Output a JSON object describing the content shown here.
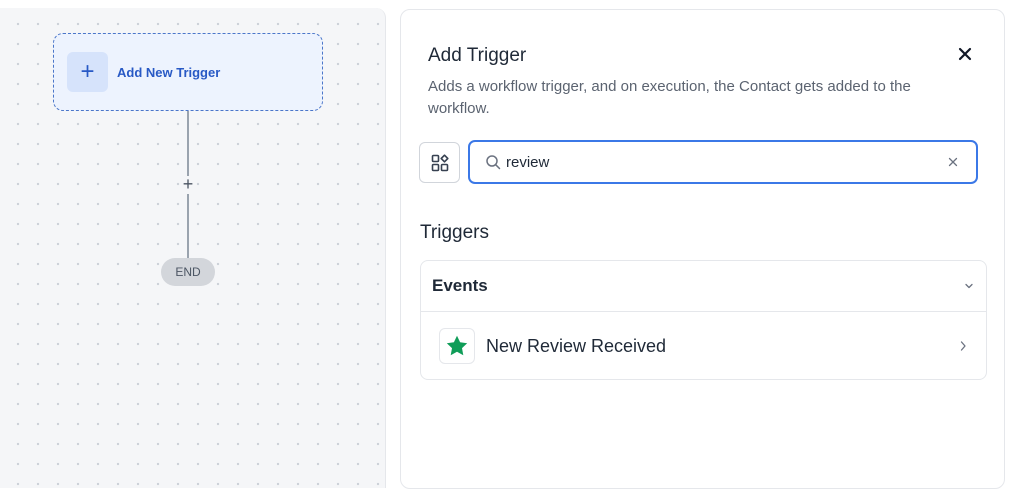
{
  "canvas": {
    "trigger_node": {
      "plus": "+",
      "label": "Add New Trigger"
    },
    "add_step": "+",
    "end_label": "END"
  },
  "panel": {
    "title": "Add Trigger",
    "description": "Adds a workflow trigger, and on execution, the Contact gets added to the workflow.",
    "search": {
      "value": "review",
      "clear_icon": "close-icon"
    },
    "section_title": "Triggers",
    "events": {
      "title": "Events",
      "items": [
        {
          "label": "New Review Received",
          "icon": "star-icon",
          "icon_color": "#0f9d58"
        }
      ]
    }
  },
  "colors": {
    "accent": "#3b78e7",
    "trigger_text": "#2859c5",
    "star": "#0f9d58"
  }
}
